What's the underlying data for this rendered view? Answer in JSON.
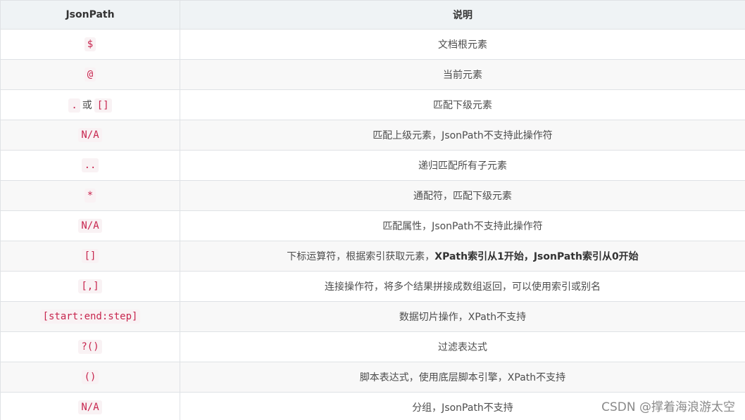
{
  "table": {
    "headers": [
      "JsonPath",
      "说明"
    ],
    "rows": [
      {
        "code": "$",
        "desc": "文档根元素"
      },
      {
        "code": "@",
        "desc": "当前元素"
      },
      {
        "code": ".",
        "connector": "或",
        "code2": "[]",
        "desc": "匹配下级元素"
      },
      {
        "code": "N/A",
        "desc": "匹配上级元素，JsonPath不支持此操作符"
      },
      {
        "code": "..",
        "desc": "递归匹配所有子元素"
      },
      {
        "code": "*",
        "desc": "通配符，匹配下级元素"
      },
      {
        "code": "N/A",
        "desc": "匹配属性，JsonPath不支持此操作符"
      },
      {
        "code": "[]",
        "desc": "下标运算符，根据索引获取元素，",
        "desc_bold": "XPath索引从1开始，JsonPath索引从0开始"
      },
      {
        "code": "[,]",
        "desc": "连接操作符，将多个结果拼接成数组返回，可以使用索引或别名"
      },
      {
        "code": "[start:end:step]",
        "desc": "数据切片操作，XPath不支持"
      },
      {
        "code": "?()",
        "desc": "过滤表达式"
      },
      {
        "code": "()",
        "desc": "脚本表达式，使用底层脚本引擎，XPath不支持"
      },
      {
        "code": "N/A",
        "desc": "分组，JsonPath不支持"
      }
    ]
  },
  "watermark": "CSDN @撑着海浪游太空"
}
